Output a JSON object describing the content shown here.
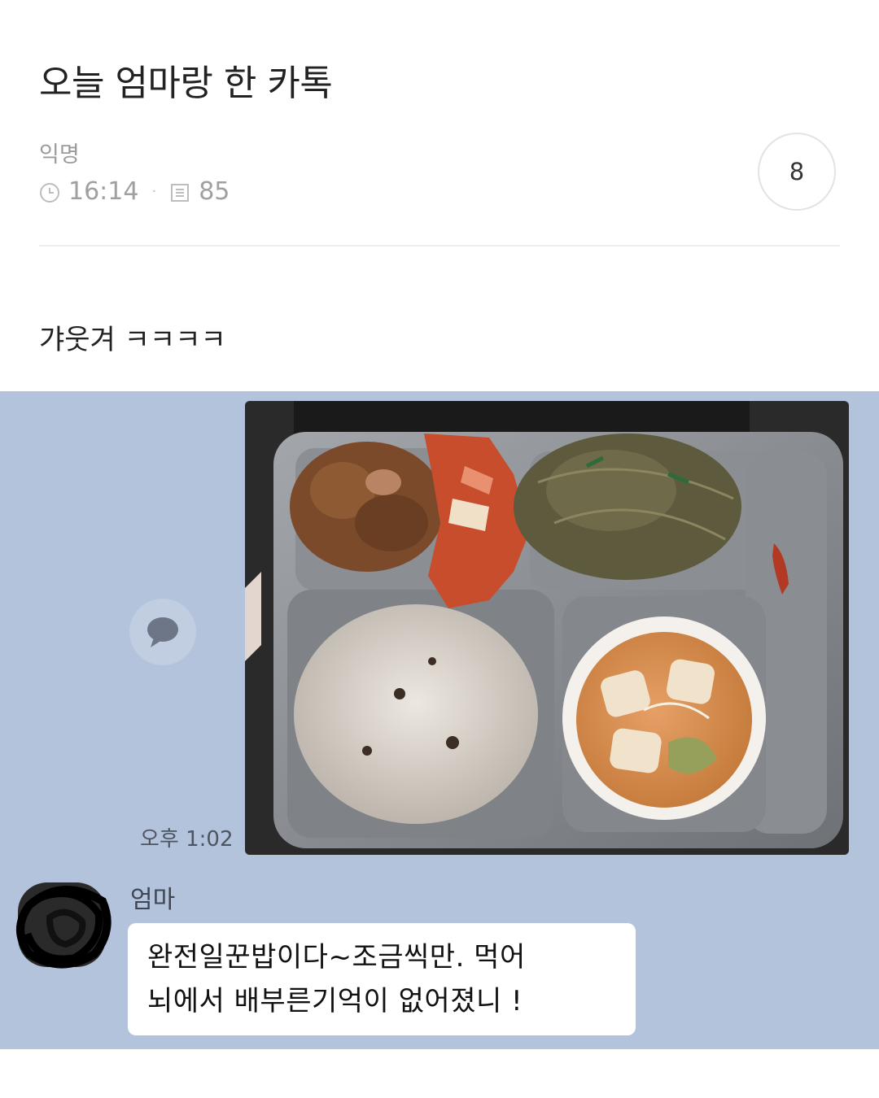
{
  "post": {
    "title": "오늘 엄마랑 한 카톡",
    "author": "익명",
    "time": "16:14",
    "views": "85",
    "comment_count": "8",
    "body": "갸웃겨 ㅋㅋㅋㅋ"
  },
  "chat": {
    "message_time": "오후 1:02",
    "sender_name": "엄마",
    "message_lines": [
      "완전일꾼밥이다~조금씩만. 먹어",
      "뇌에서 배부른기억이 없어졌니 !"
    ],
    "icons": [
      "clock-icon",
      "views-icon",
      "speech-bubble-icon"
    ],
    "colors": {
      "chat_background": "#b3c3db",
      "bubble": "#ffffff"
    }
  }
}
